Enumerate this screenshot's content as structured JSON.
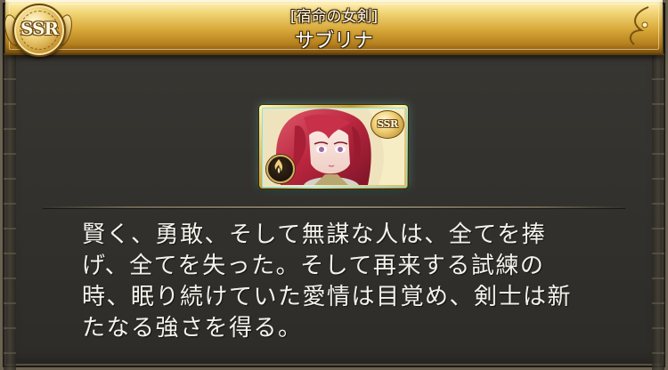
{
  "dialog": {
    "rarity_badge": "SSR",
    "subtitle": "[宿命の女剣]",
    "name": "サブリナ",
    "card": {
      "rarity_badge": "SSR",
      "element_icon": "flame-icon"
    },
    "description": "賢く、勇敢、そして無謀な人は、全てを捧\nげ、全てを失った。そして再来する試練の\n時、眠り続けていた愛情は目覚め、剣士は新\nたなる強さを得る。"
  },
  "colors": {
    "banner_gold": "#d8a93a",
    "panel_bg": "#34322e",
    "text": "#f4f2ea",
    "card_glow": "#7fe8e0"
  }
}
